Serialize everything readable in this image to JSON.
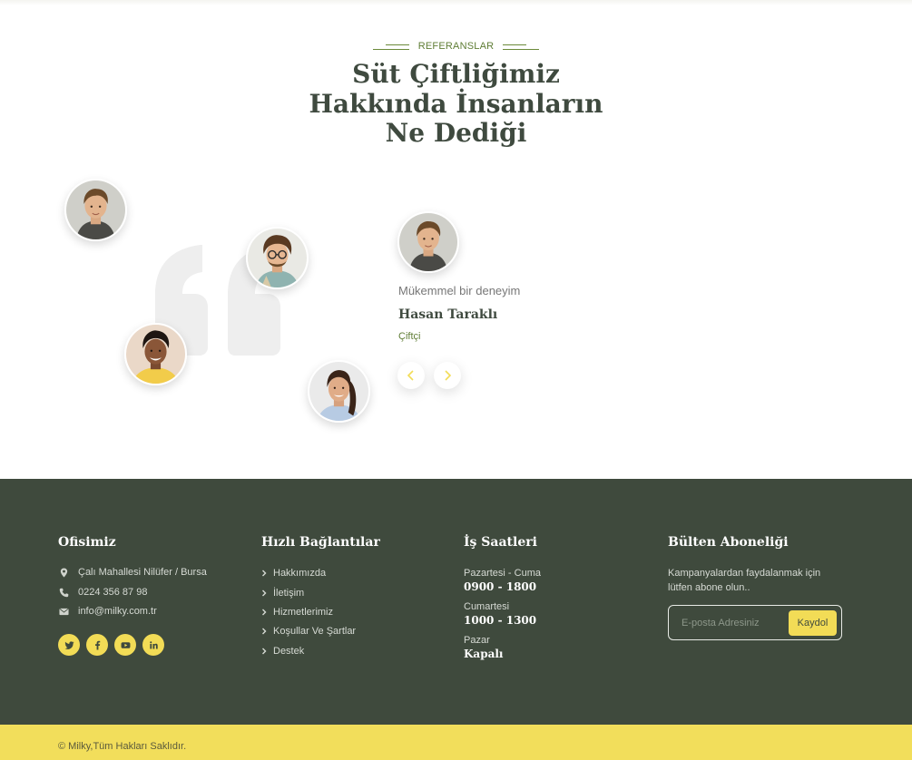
{
  "testimonials": {
    "eyebrow": "REFERANSLAR",
    "title_lines": [
      "Süt Çiftliğimiz",
      "Hakkında İnsanların",
      "Ne Dediği"
    ],
    "active": {
      "text": "Mükemmel bir deneyim",
      "name": "Hasan Taraklı",
      "role": "Çiftçi"
    }
  },
  "footer": {
    "office": {
      "heading": "Ofisimiz",
      "address": "Çalı Mahallesi Nilüfer / Bursa",
      "phone": "0224 356 87 98",
      "email": "info@milky.com.tr",
      "socials": [
        "twitter-icon",
        "facebook-icon",
        "youtube-icon",
        "linkedin-icon"
      ]
    },
    "quick_links": {
      "heading": "Hızlı Bağlantılar",
      "items": [
        "Hakkımızda",
        "İletişim",
        "Hizmetlerimiz",
        "Koşullar Ve Şartlar",
        "Destek"
      ]
    },
    "hours": {
      "heading": "İş Saatleri",
      "rows": [
        {
          "day": "Pazartesi - Cuma",
          "time": "0900 - 1800"
        },
        {
          "day": "Cumartesi",
          "time": "1000 - 1300"
        },
        {
          "day": "Pazar",
          "time": "Kapalı"
        }
      ]
    },
    "newsletter": {
      "heading": "Bülten Aboneliği",
      "text": "Kampanyalardan faydalanmak için lütfen abone olun..",
      "placeholder": "E-posta Adresiniz",
      "button": "Kaydol"
    },
    "copyright": "© Milky,Tüm Hakları Saklıdır."
  },
  "colors": {
    "accent_green": "#5f7d35",
    "footer_bg": "#3f4a3d",
    "accent_yellow": "#f2dc56"
  }
}
